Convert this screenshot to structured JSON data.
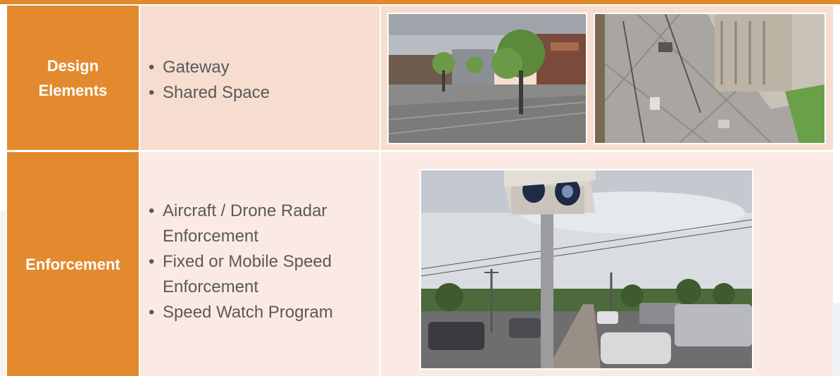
{
  "rows": [
    {
      "heading_line1": "Design",
      "heading_line2": "Elements",
      "items": [
        "Gateway",
        "Shared Space"
      ]
    },
    {
      "heading": "Enforcement",
      "items": [
        {
          "line1": "Aircraft / Drone Radar",
          "line2": "Enforcement"
        },
        {
          "line1": "Fixed or Mobile Speed",
          "line2": "Enforcement"
        },
        {
          "line1": "Speed Watch Program",
          "line2": ""
        }
      ]
    }
  ],
  "bullet": "•",
  "colors": {
    "accent": "#e38a2f",
    "row1_bg": "#f6ddd0",
    "row2_bg": "#fbeae3",
    "text": "#595959"
  }
}
